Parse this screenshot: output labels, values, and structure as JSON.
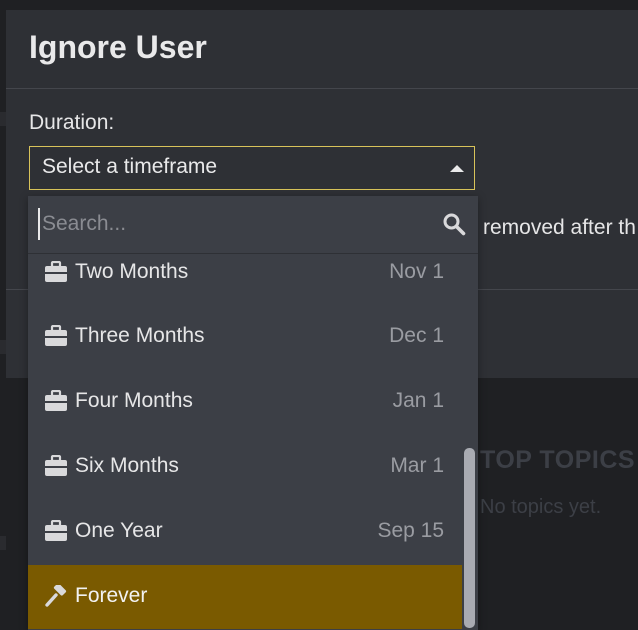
{
  "background": {
    "top_topics_title": "TOP TOPICS",
    "top_topics_empty": "No topics yet."
  },
  "modal": {
    "title": "Ignore User",
    "duration_label": "Duration:",
    "select_value": "Select a timeframe",
    "note_fragment": "removed after th"
  },
  "dropdown": {
    "search_placeholder": "Search...",
    "options": [
      {
        "label": "Two Months",
        "date": "Nov 1",
        "icon": "briefcase-icon",
        "selected": false
      },
      {
        "label": "Three Months",
        "date": "Dec 1",
        "icon": "briefcase-icon",
        "selected": false
      },
      {
        "label": "Four Months",
        "date": "Jan 1",
        "icon": "briefcase-icon",
        "selected": false
      },
      {
        "label": "Six Months",
        "date": "Mar 1",
        "icon": "briefcase-icon",
        "selected": false
      },
      {
        "label": "One Year",
        "date": "Sep 15",
        "icon": "briefcase-icon",
        "selected": false
      },
      {
        "label": "Forever",
        "date": "",
        "icon": "gavel-icon",
        "selected": true
      }
    ]
  },
  "colors": {
    "accent_border": "#d8c35a",
    "selected_bg": "#7a5a00",
    "modal_bg": "#2e3035",
    "dropdown_bg": "#3c3f46"
  }
}
